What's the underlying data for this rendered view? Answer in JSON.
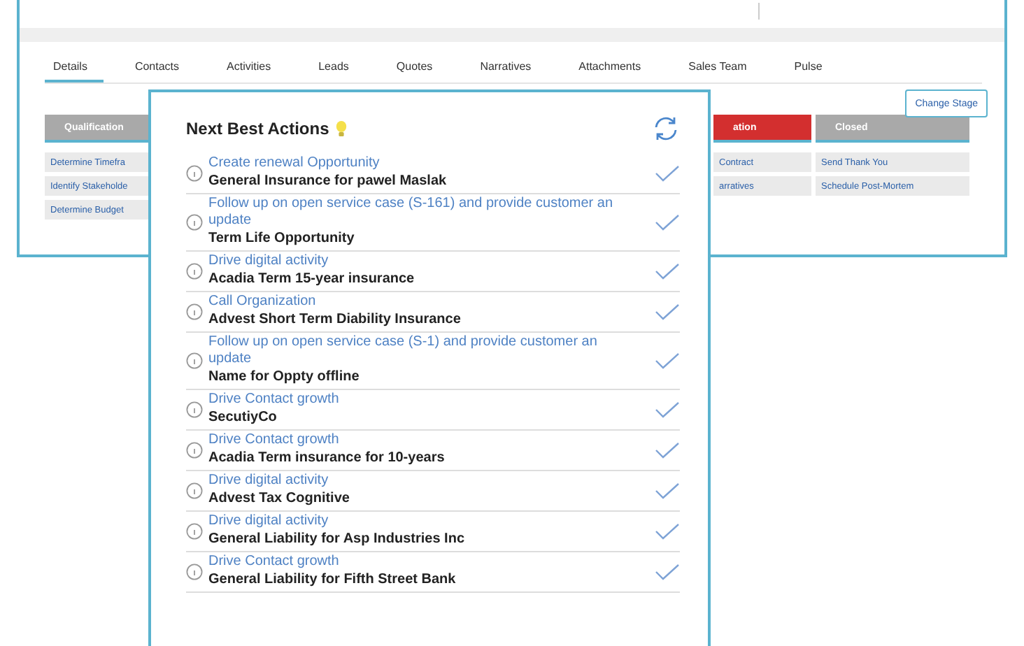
{
  "tabs": [
    {
      "label": "Details",
      "selected": true
    },
    {
      "label": "Contacts",
      "selected": false
    },
    {
      "label": "Activities",
      "selected": false
    },
    {
      "label": "Leads",
      "selected": false
    },
    {
      "label": "Quotes",
      "selected": false
    },
    {
      "label": "Narratives",
      "selected": false
    },
    {
      "label": "Attachments",
      "selected": false
    },
    {
      "label": "Sales Team",
      "selected": false
    },
    {
      "label": "Pulse",
      "selected": false
    }
  ],
  "change_stage_button": "Change Stage",
  "stages_left": [
    {
      "label": "Qualification",
      "current": false,
      "tasks": [
        "Determine Timefra",
        "Identify Stakeholde",
        "Determine Budget"
      ]
    }
  ],
  "stages_right": [
    {
      "label": "ation",
      "current": true,
      "tasks": [
        "Contract",
        "arratives"
      ]
    },
    {
      "label": "Closed",
      "current": false,
      "tasks": [
        "Send Thank You",
        "Schedule Post-Mortem"
      ]
    }
  ],
  "next_best_actions": {
    "title": "Next Best Actions",
    "actions": [
      {
        "action": "Create renewal Opportunity",
        "subject": "General Insurance for pawel Maslak"
      },
      {
        "action": "Follow up on open service case (S-161) and provide customer an update",
        "subject": "Term Life Opportunity"
      },
      {
        "action": "Drive digital activity",
        "subject": "Acadia Term 15-year insurance"
      },
      {
        "action": "Call Organization",
        "subject": "Advest Short Term Diability Insurance"
      },
      {
        "action": "Follow up on open service case (S-1) and provide customer an update",
        "subject": "Name for Oppty offline"
      },
      {
        "action": "Drive Contact growth",
        "subject": "SecutiyCo"
      },
      {
        "action": "Drive Contact growth",
        "subject": "Acadia Term insurance for 10-years"
      },
      {
        "action": "Drive digital activity",
        "subject": "Advest Tax Cognitive"
      },
      {
        "action": "Drive digital activity",
        "subject": "General Liability for Asp Industries Inc"
      },
      {
        "action": "Drive Contact growth",
        "subject": "General Liability for Fifth Street Bank"
      }
    ]
  }
}
